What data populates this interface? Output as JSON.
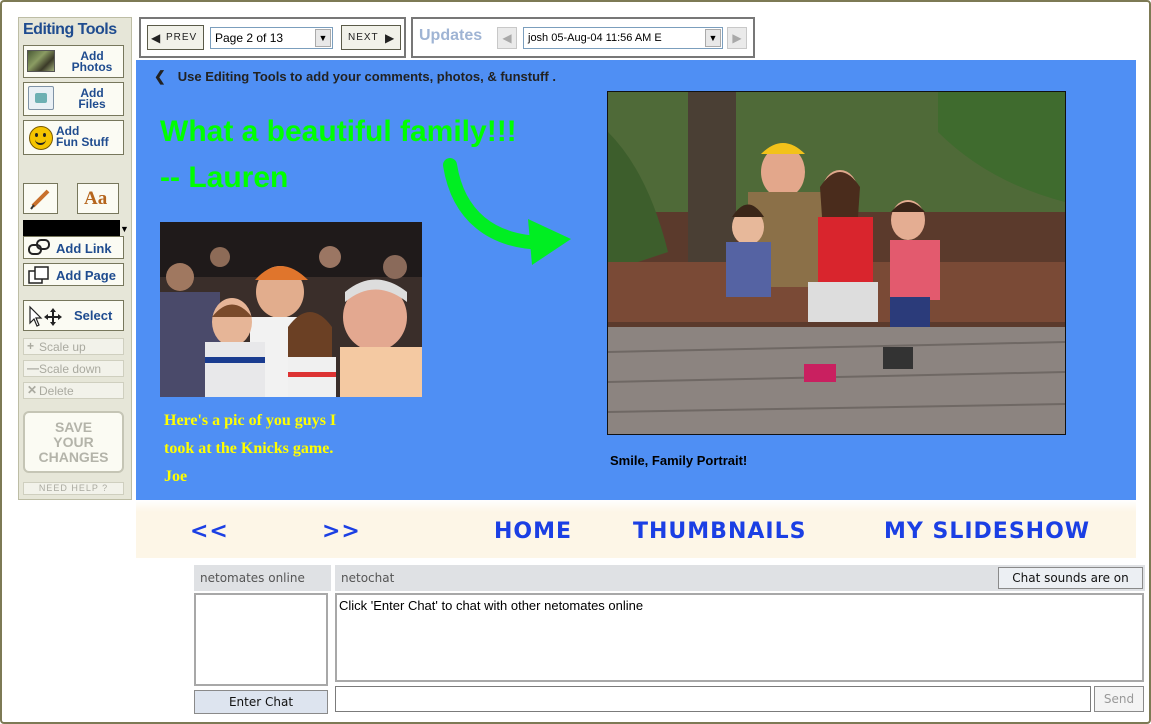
{
  "sidebar": {
    "title": "Editing Tools",
    "add_photos": [
      "Add",
      "Photos"
    ],
    "add_files": [
      "Add",
      "Files"
    ],
    "add_fun_stuff": [
      "Add",
      "Fun Stuff"
    ],
    "text_tool_label": "Aa",
    "color_value": "#000000",
    "add_link": "Add Link",
    "add_page": "Add Page",
    "select": "Select",
    "scale_up": "Scale up",
    "scale_down": "Scale down",
    "delete": "Delete",
    "save": [
      "SAVE",
      "YOUR",
      "CHANGES"
    ],
    "help": "NEED HELP ?"
  },
  "pager": {
    "prev": "PREV",
    "page_select": "Page 2 of 13",
    "next": "NEXT"
  },
  "updates": {
    "label": "Updates",
    "select": "josh 05-Aug-04 11:56 AM E"
  },
  "canvas": {
    "instruction": "Use Editing Tools to add your comments, photos, & funstuff .",
    "green_line1": "What a beautiful family!!!",
    "green_line2": "-- Lauren",
    "caption_left": [
      "Here's a pic of you guys I",
      "took at the Knicks game.",
      "Joe"
    ],
    "caption_right": "Smile, Family Portrait!"
  },
  "bottom_nav": {
    "prev": "<<",
    "next": ">>",
    "home": "HOME",
    "thumbnails": "THUMBNAILS",
    "slideshow": "MY SLIDESHOW"
  },
  "chat": {
    "online_header": "netomates online",
    "chat_header": "netochat",
    "sounds_button": "Chat sounds are on",
    "message": "Click 'Enter Chat' to chat with other netomates online",
    "enter_button": "Enter Chat",
    "send_button": "Send",
    "input_value": ""
  },
  "colors": {
    "canvas_bg": "#4f8ff4",
    "green_text": "#00ff00",
    "yellow_text": "#ffff00",
    "nav_blue": "#1b3fe4"
  }
}
